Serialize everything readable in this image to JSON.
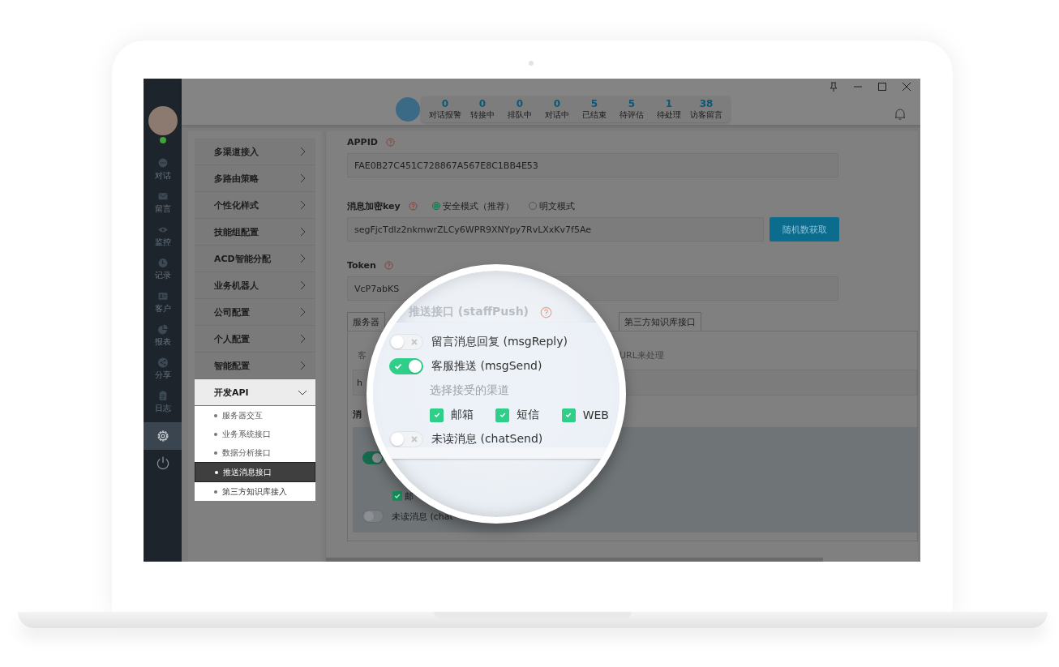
{
  "stats": [
    {
      "value": "0",
      "label": "对话报警"
    },
    {
      "value": "0",
      "label": "转接中"
    },
    {
      "value": "0",
      "label": "排队中"
    },
    {
      "value": "0",
      "label": "对话中"
    },
    {
      "value": "5",
      "label": "已结束"
    },
    {
      "value": "5",
      "label": "待评估"
    },
    {
      "value": "1",
      "label": "待处理"
    },
    {
      "value": "38",
      "label": "访客留言"
    }
  ],
  "rail": [
    {
      "kind": "chat",
      "label": "对话",
      "selected": false
    },
    {
      "kind": "mail",
      "label": "留言",
      "selected": false
    },
    {
      "kind": "eye",
      "label": "监控",
      "selected": false
    },
    {
      "kind": "clock",
      "label": "记录",
      "selected": false
    },
    {
      "kind": "card",
      "label": "客户",
      "selected": false
    },
    {
      "kind": "pie",
      "label": "报表",
      "selected": false
    },
    {
      "kind": "share",
      "label": "分享",
      "selected": false
    },
    {
      "kind": "clipboard",
      "label": "日志",
      "selected": false
    },
    {
      "kind": "gear",
      "selected": true
    },
    {
      "kind": "power",
      "selected": false
    }
  ],
  "menu": [
    {
      "label": "多渠道接入",
      "expanded": false
    },
    {
      "label": "多路由策略",
      "expanded": false
    },
    {
      "label": "个性化样式",
      "expanded": false
    },
    {
      "label": "技能组配置",
      "expanded": false
    },
    {
      "label": "ACD智能分配",
      "expanded": false
    },
    {
      "label": "业务机器人",
      "expanded": false
    },
    {
      "label": "公司配置",
      "expanded": false
    },
    {
      "label": "个人配置",
      "expanded": false
    },
    {
      "label": "智能配置",
      "expanded": false
    },
    {
      "label": "开发API",
      "expanded": true,
      "children": [
        {
          "label": "服务器交互",
          "selected": false
        },
        {
          "label": "业务系统接口",
          "selected": false
        },
        {
          "label": "数据分析接口",
          "selected": false
        },
        {
          "label": "推送消息接口",
          "selected": true
        },
        {
          "label": "第三方知识库接入",
          "selected": false
        }
      ]
    }
  ],
  "form": {
    "appid": {
      "label": "APPID",
      "value": "FAE0B27C451C728867A567E8C1BB4E53"
    },
    "key": {
      "label": "消息加密key",
      "modes": [
        {
          "label": "安全模式（推荐）",
          "selected": true
        },
        {
          "label": "明文模式",
          "selected": false
        }
      ],
      "value": "segFjcTdlz2nkmwrZLCy6WPR9XNYpy7RvLXxKv7f5Ae",
      "button": "随机数获取"
    },
    "token": {
      "label": "Token",
      "value": "VcP7abKS"
    },
    "tabs": [
      {
        "label": "服务器",
        "selected": false
      },
      {
        "label": "第三方知识库接口",
        "selected": false
      }
    ],
    "hint_start": "客",
    "hint_end": "URL来处理",
    "url_value": "h",
    "section_label": "消",
    "lower": [
      {
        "kind": "toggle",
        "on": true
      },
      {
        "kind": "checkbox",
        "checked": true,
        "label": "邮"
      },
      {
        "kind": "toggle",
        "on": false,
        "label": "未读消息 (chat"
      }
    ]
  },
  "magnifier": {
    "title": "推送接口 (staffPush)",
    "items": [
      {
        "kind": "toggle",
        "on": false,
        "label": "留言消息回复 (msgReply)"
      },
      {
        "kind": "toggle",
        "on": true,
        "label": "客服推送 (msgSend)"
      },
      {
        "kind": "caption",
        "label": "选择接受的渠道"
      },
      {
        "kind": "channels",
        "options": [
          {
            "label": "邮箱",
            "checked": true
          },
          {
            "label": "短信",
            "checked": true
          },
          {
            "label": "WEB",
            "checked": true
          }
        ]
      },
      {
        "kind": "toggle",
        "on": false,
        "label": "未读消息 (chatSend)"
      }
    ]
  }
}
